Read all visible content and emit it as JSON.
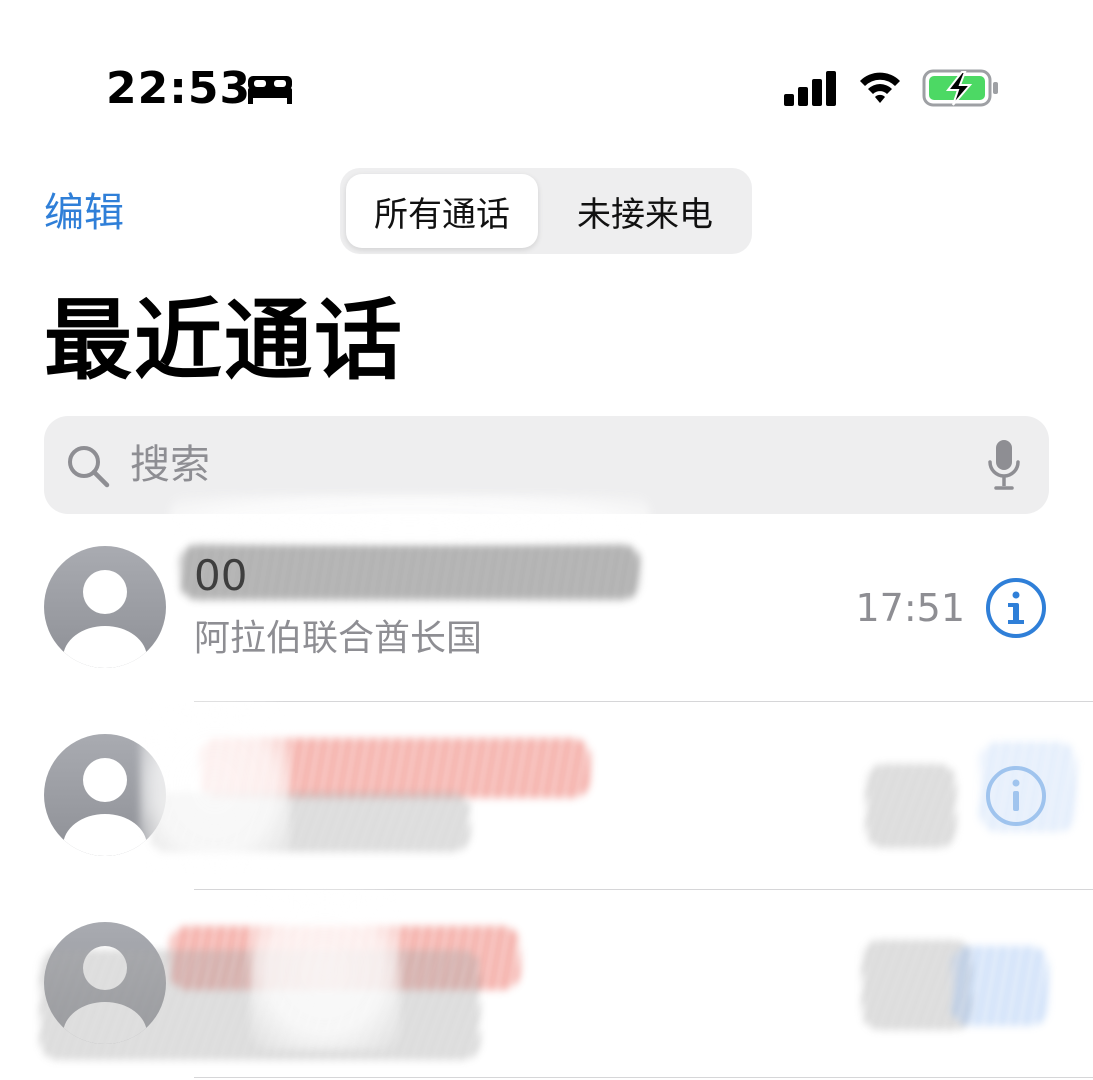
{
  "status_bar": {
    "time": "22:53",
    "icons": [
      "sleep-icon",
      "signal-icon",
      "wifi-icon",
      "battery-charging-icon"
    ],
    "battery_color": "#4cd964"
  },
  "nav": {
    "edit_label": "编辑",
    "segments": {
      "all": "所有通话",
      "missed": "未接来电"
    },
    "selected_segment": "所有通话"
  },
  "title": "最近通话",
  "search": {
    "placeholder": "搜索",
    "value": ""
  },
  "calls": [
    {
      "name": "00",
      "subtitle": "阿拉伯联合酋长国",
      "time": "17:51",
      "redacted": true
    },
    {
      "name": "",
      "subtitle": "",
      "time": "",
      "redacted": true
    },
    {
      "name": "",
      "subtitle": "",
      "time": "",
      "redacted": true
    }
  ],
  "colors": {
    "accent": "#2f7fd8",
    "secondary_text": "#8e8e93",
    "avatar": "#a3a5ab"
  }
}
